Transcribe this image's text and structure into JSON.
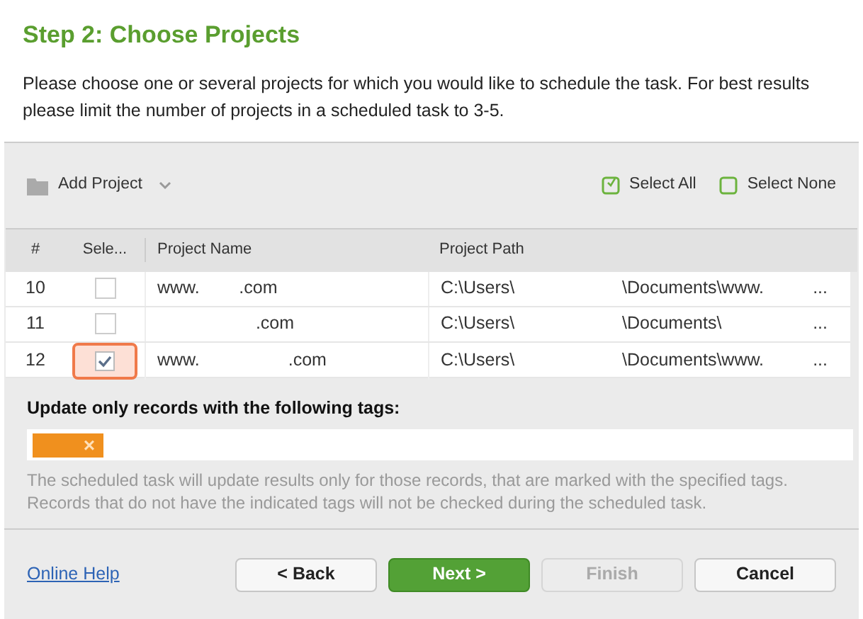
{
  "title": "Step 2: Choose Projects",
  "description": "Please choose one or several projects for which you would like to schedule the task. For best results please limit the number of projects in a scheduled task to 3-5.",
  "toolbar": {
    "add_project": "Add Project",
    "select_all": "Select All",
    "select_none": "Select None"
  },
  "table": {
    "columns": [
      "#",
      "Sele...",
      "Project Name",
      "Project Path"
    ],
    "rows": [
      {
        "number": "10",
        "selected": false,
        "name": "www.        .com",
        "path": "C:\\Users\\",
        "path_2": "\\Documents\\www.",
        "more": "..."
      },
      {
        "number": "11",
        "selected": false,
        "name": "                    .com",
        "path": "C:\\Users\\",
        "path_2": "\\Documents\\",
        "more": "..."
      },
      {
        "number": "12",
        "selected": true,
        "name": "www.                  .com",
        "path": "C:\\Users\\",
        "path_2": "\\Documents\\www.",
        "more": "..."
      }
    ]
  },
  "tags": {
    "label": "Update only records with the following tags:",
    "items": [
      {
        "color": "#f0901e",
        "remove": "×"
      }
    ],
    "note": "The scheduled task will update results only for those records, that are marked with the specified tags. Records that do not have the indicated tags will not be checked during the scheduled task."
  },
  "footer": {
    "help": "Online Help",
    "buttons": [
      {
        "label": "< Back",
        "kind": "default",
        "disabled": false
      },
      {
        "label": "Next >",
        "kind": "primary",
        "disabled": false
      },
      {
        "label": "Finish",
        "kind": "default",
        "disabled": true
      },
      {
        "label": "Cancel",
        "kind": "default",
        "disabled": false
      }
    ]
  }
}
